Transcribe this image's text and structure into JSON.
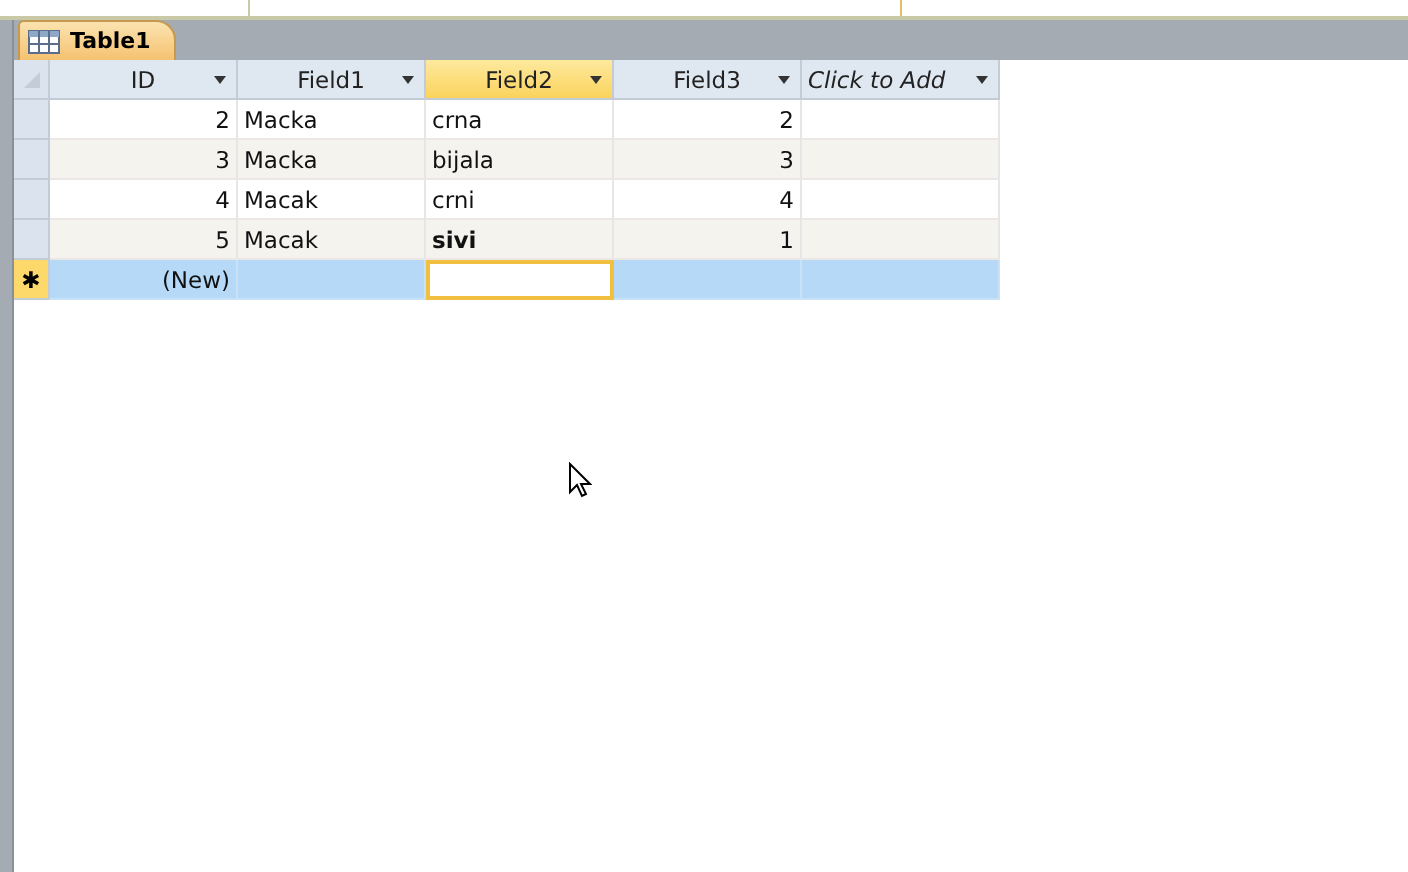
{
  "tab": {
    "label": "Table1",
    "selected": true
  },
  "columns": [
    {
      "label": "ID",
      "selected": false,
      "kind": "field"
    },
    {
      "label": "Field1",
      "selected": false,
      "kind": "field"
    },
    {
      "label": "Field2",
      "selected": true,
      "kind": "field"
    },
    {
      "label": "Field3",
      "selected": false,
      "kind": "field"
    },
    {
      "label": "Click to Add",
      "selected": false,
      "kind": "add"
    }
  ],
  "rows": [
    {
      "cells": [
        "2",
        "Macka",
        "crna",
        "2",
        ""
      ],
      "bold": false
    },
    {
      "cells": [
        "3",
        "Macka",
        "bijala",
        "3",
        ""
      ],
      "bold": false
    },
    {
      "cells": [
        "4",
        "Macak",
        "crni",
        "4",
        ""
      ],
      "bold": false
    },
    {
      "cells": [
        "5",
        "Macak",
        "sivi",
        "1",
        ""
      ],
      "bold": true
    }
  ],
  "new_row": {
    "marker": "✱",
    "selected": true,
    "cells": [
      {
        "text": "(New)",
        "focused": false
      },
      {
        "focused": false
      },
      {
        "focused": true
      },
      {
        "focused": false
      },
      {
        "focused": false
      }
    ]
  }
}
